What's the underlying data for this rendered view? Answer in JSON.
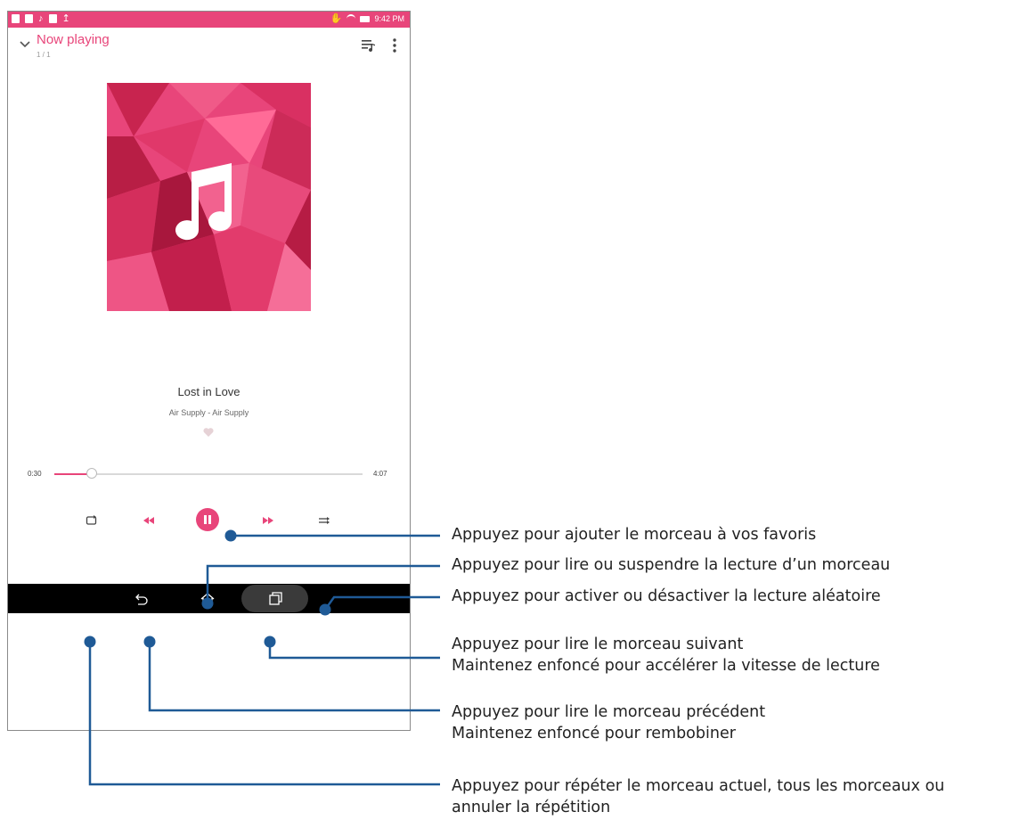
{
  "status_bar": {
    "time": "9:42 PM"
  },
  "header": {
    "title": "Now playing",
    "subtitle": "1 / 1"
  },
  "track": {
    "title": "Lost in Love",
    "artist": "Air Supply - Air Supply",
    "time_current": "0:30",
    "time_total": "4:07",
    "progress": 0.12
  },
  "colors": {
    "accent": "#e8457a",
    "navbar": "#000000",
    "callout_line": "#1f5a96"
  },
  "icons": {
    "collapse": "chevron-down-icon",
    "queue": "queue-music-icon",
    "more": "more-vertical-icon",
    "favorite": "heart-icon",
    "repeat": "repeat-icon",
    "previous": "rewind-icon",
    "play_pause": "pause-icon",
    "next": "fast-forward-icon",
    "shuffle": "shuffle-icon",
    "back": "back-icon",
    "home": "home-icon",
    "recents": "recents-icon"
  },
  "callouts": [
    {
      "id": "favorite",
      "text": "Appuyez pour ajouter le morceau à vos favoris"
    },
    {
      "id": "play-pause",
      "text": "Appuyez pour lire ou suspendre la lecture d’un morceau"
    },
    {
      "id": "shuffle",
      "text": "Appuyez pour activer ou désactiver la lecture aléatoire"
    },
    {
      "id": "next",
      "line1": "Appuyez pour lire le morceau suivant",
      "line2": "Maintenez enfoncé pour accélérer la vitesse de lecture"
    },
    {
      "id": "previous",
      "line1": "Appuyez pour lire le morceau précédent",
      "line2": "Maintenez enfoncé pour rembobiner"
    },
    {
      "id": "repeat",
      "line1": "Appuyez pour répéter le morceau actuel, tous les morceaux ou",
      "line2": "annuler la répétition"
    }
  ]
}
